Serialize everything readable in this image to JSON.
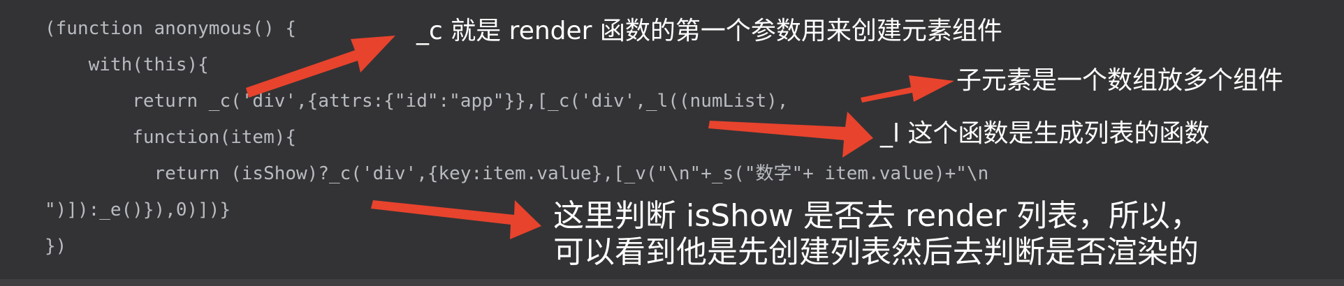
{
  "code": {
    "lines": [
      "(function anonymous() {",
      "    with(this){",
      "        return _c('div',{attrs:{\"id\":\"app\"}},[_c('div',_l((numList),",
      "        function(item){",
      "          return (isShow)?_c('div',{key:item.value},[_v(\"\\n\"+_s(\"数字\"+ item.value)+\"\\n",
      "\")]):_e()}),0)])}",
      "})"
    ]
  },
  "annotations": {
    "c_explanation": "_c 就是 render 函数的第一个参数用来创建元素组件",
    "children_explanation": "子元素是一个数组放多个组件",
    "l_explanation": "_l 这个函数是生成列表的函数",
    "isshow_line1": "这里判断 isShow 是否去 render 列表，所以，",
    "isshow_line2": "可以看到他是先创建列表然后去判断是否渲染的"
  },
  "colors": {
    "background": "#333335",
    "code_text": "#b9bcc1",
    "annotation_text": "#ffffff",
    "arrow": "#e8432d"
  }
}
